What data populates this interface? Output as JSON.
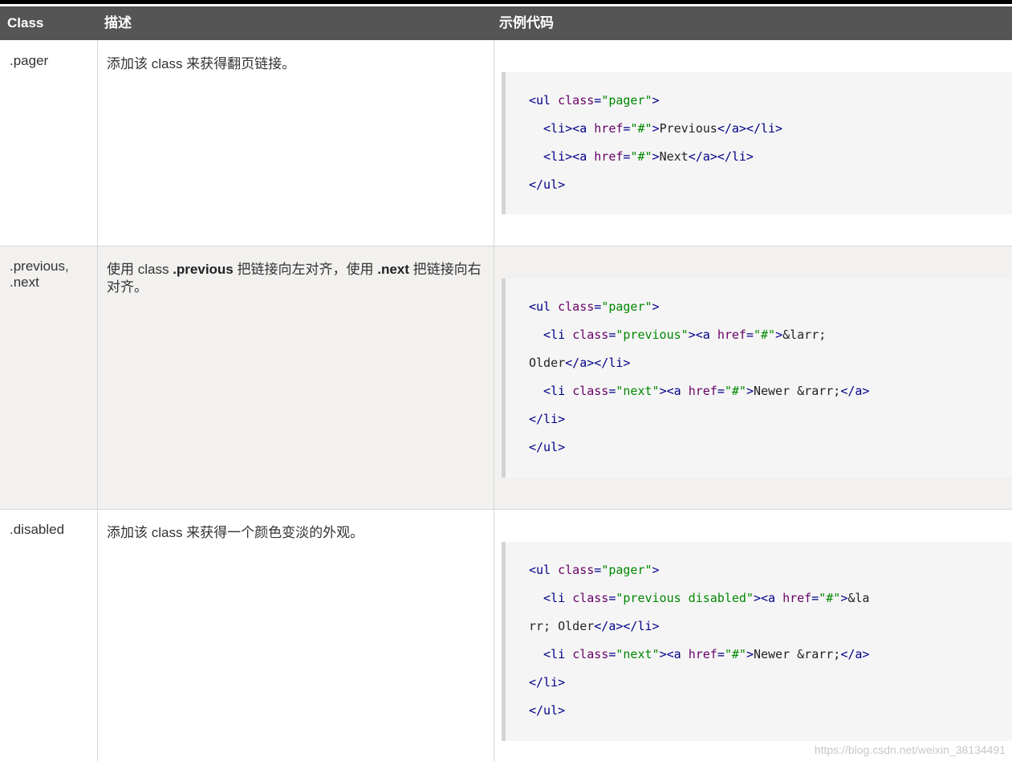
{
  "header": {
    "col_class": "Class",
    "col_desc": "描述",
    "col_code": "示例代码"
  },
  "rows": [
    {
      "class": ".pager",
      "desc_pre": "添加该 class 来获得翻页链接。",
      "code": [
        [
          [
            "tag",
            "<ul "
          ],
          [
            "atn",
            "class"
          ],
          [
            "tag",
            "="
          ],
          [
            "atv",
            "\"pager\""
          ],
          [
            "tag",
            ">"
          ]
        ],
        [
          [
            "tag",
            "  <li><a "
          ],
          [
            "atn",
            "href"
          ],
          [
            "tag",
            "="
          ],
          [
            "atv",
            "\"#\""
          ],
          [
            "tag",
            ">"
          ],
          [
            "p",
            "Previous"
          ],
          [
            "tag",
            "</a></li>"
          ]
        ],
        [
          [
            "tag",
            "  <li><a "
          ],
          [
            "atn",
            "href"
          ],
          [
            "tag",
            "="
          ],
          [
            "atv",
            "\"#\""
          ],
          [
            "tag",
            ">"
          ],
          [
            "p",
            "Next"
          ],
          [
            "tag",
            "</a></li>"
          ]
        ],
        [
          [
            "tag",
            "</ul>"
          ]
        ]
      ]
    },
    {
      "class": ".previous,\n.next",
      "desc_pre": "使用 class ",
      "desc_b1": ".previous",
      "desc_mid": " 把链接向左对齐，使用 ",
      "desc_b2": ".next",
      "desc_post": " 把链接向右对齐。",
      "code": [
        [
          [
            "tag",
            "<ul "
          ],
          [
            "atn",
            "class"
          ],
          [
            "tag",
            "="
          ],
          [
            "atv",
            "\"pager\""
          ],
          [
            "tag",
            ">"
          ]
        ],
        [
          [
            "tag",
            "  <li "
          ],
          [
            "atn",
            "class"
          ],
          [
            "tag",
            "="
          ],
          [
            "atv",
            "\"previous\""
          ],
          [
            "tag",
            "><a "
          ],
          [
            "atn",
            "href"
          ],
          [
            "tag",
            "="
          ],
          [
            "atv",
            "\"#\""
          ],
          [
            "tag",
            ">"
          ],
          [
            "p",
            "&larr;"
          ]
        ],
        [
          [
            "p",
            "Older"
          ],
          [
            "tag",
            "</a></li>"
          ]
        ],
        [
          [
            "tag",
            "  <li "
          ],
          [
            "atn",
            "class"
          ],
          [
            "tag",
            "="
          ],
          [
            "atv",
            "\"next\""
          ],
          [
            "tag",
            "><a "
          ],
          [
            "atn",
            "href"
          ],
          [
            "tag",
            "="
          ],
          [
            "atv",
            "\"#\""
          ],
          [
            "tag",
            ">"
          ],
          [
            "p",
            "Newer &rarr;"
          ],
          [
            "tag",
            "</a>"
          ]
        ],
        [
          [
            "tag",
            "</li>"
          ]
        ],
        [
          [
            "tag",
            "</ul>"
          ]
        ]
      ]
    },
    {
      "class": ".disabled",
      "desc_pre": "添加该 class 来获得一个颜色变淡的外观。",
      "code": [
        [
          [
            "tag",
            "<ul "
          ],
          [
            "atn",
            "class"
          ],
          [
            "tag",
            "="
          ],
          [
            "atv",
            "\"pager\""
          ],
          [
            "tag",
            ">"
          ]
        ],
        [
          [
            "tag",
            "  <li "
          ],
          [
            "atn",
            "class"
          ],
          [
            "tag",
            "="
          ],
          [
            "atv",
            "\"previous disabled\""
          ],
          [
            "tag",
            "><a "
          ],
          [
            "atn",
            "href"
          ],
          [
            "tag",
            "="
          ],
          [
            "atv",
            "\"#\""
          ],
          [
            "tag",
            ">"
          ],
          [
            "p",
            "&la"
          ]
        ],
        [
          [
            "p",
            "rr; Older"
          ],
          [
            "tag",
            "</a></li>"
          ]
        ],
        [
          [
            "tag",
            "  <li "
          ],
          [
            "atn",
            "class"
          ],
          [
            "tag",
            "="
          ],
          [
            "atv",
            "\"next\""
          ],
          [
            "tag",
            "><a "
          ],
          [
            "atn",
            "href"
          ],
          [
            "tag",
            "="
          ],
          [
            "atv",
            "\"#\""
          ],
          [
            "tag",
            ">"
          ],
          [
            "p",
            "Newer &rarr;"
          ],
          [
            "tag",
            "</a>"
          ]
        ],
        [
          [
            "tag",
            "</li>"
          ]
        ],
        [
          [
            "tag",
            "</ul>"
          ]
        ]
      ]
    }
  ],
  "watermark": "https://blog.csdn.net/weixin_38134491",
  "colors": {
    "header_bg": "#555555",
    "alt_row_bg": "#f2f1ef",
    "tag": "#000088",
    "attr_name": "#660066",
    "attr_value": "#008800"
  }
}
